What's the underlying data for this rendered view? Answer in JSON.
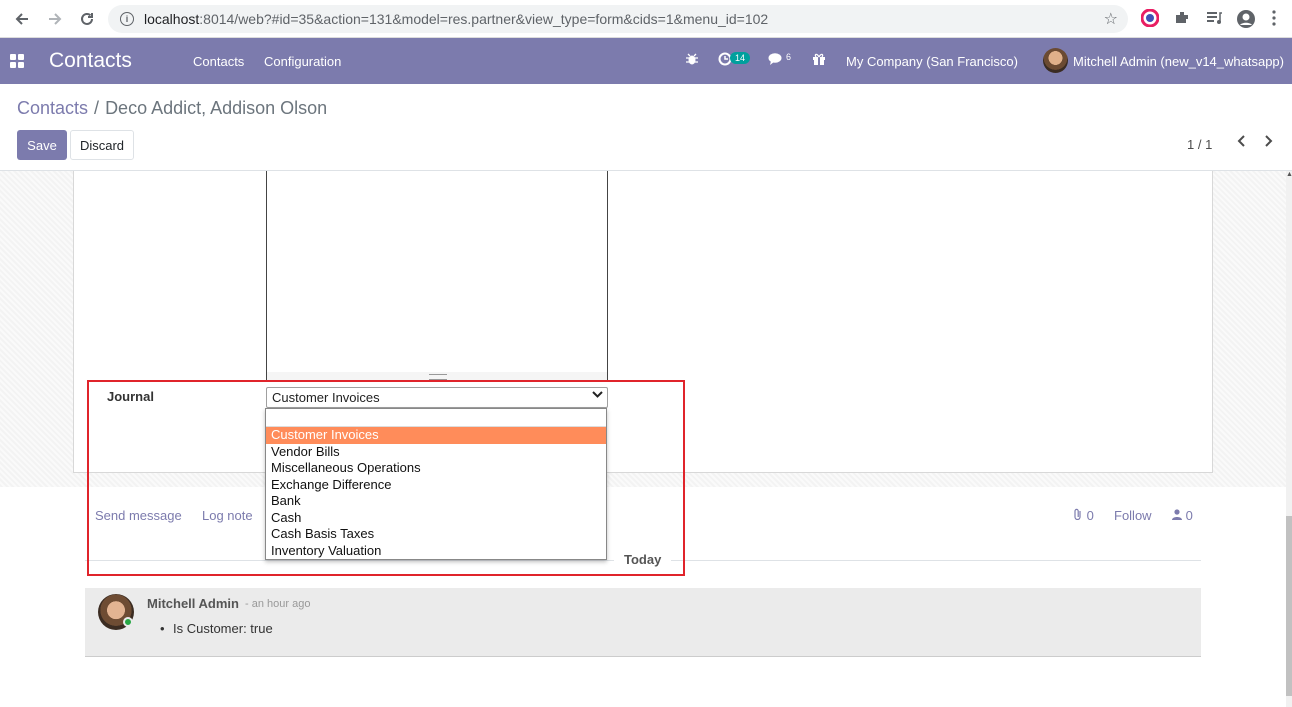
{
  "browser": {
    "url_host": "localhost",
    "url_rest": ":8014/web?#id=35&action=131&model=res.partner&view_type=form&cids=1&menu_id=102"
  },
  "navbar": {
    "app_name": "Contacts",
    "menu": [
      "Contacts",
      "Configuration"
    ],
    "activity_count": "14",
    "message_count": "6",
    "company": "My Company (San Francisco)",
    "user": "Mitchell Admin (new_v14_whatsapp)"
  },
  "control_panel": {
    "breadcrumb_parent": "Contacts",
    "breadcrumb_separator": "/",
    "breadcrumb_current": "Deco Addict, Addison Olson",
    "save_label": "Save",
    "discard_label": "Discard",
    "pager": "1 / 1"
  },
  "form": {
    "journal_label": "Journal",
    "journal_value": "Customer Invoices",
    "journal_options": [
      "Customer Invoices",
      "Vendor Bills",
      "Miscellaneous Operations",
      "Exchange Difference",
      "Bank",
      "Cash",
      "Cash Basis Taxes",
      "Inventory Valuation"
    ]
  },
  "chatter": {
    "send_message": "Send message",
    "log_note": "Log note",
    "attachments_count": "0",
    "follow": "Follow",
    "followers_count": "0",
    "today": "Today",
    "message": {
      "author": "Mitchell Admin",
      "time": "- an hour ago",
      "body": "Is Customer: true"
    }
  },
  "colors": {
    "brand": "#7c7bad",
    "selected_option": "#ff8c5a",
    "highlight": "#e0242b"
  }
}
